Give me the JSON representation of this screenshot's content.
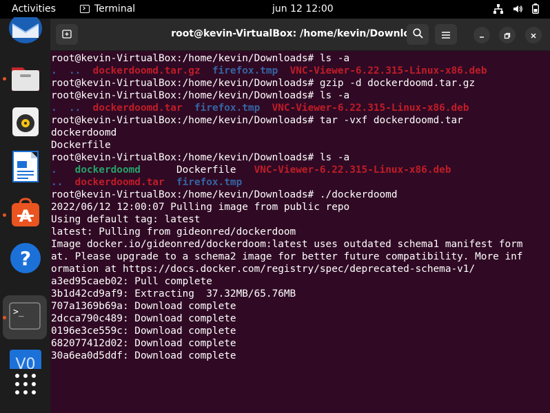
{
  "topbar": {
    "activities": "Activities",
    "app_name": "Terminal",
    "clock": "jun 12  12:00"
  },
  "dock": {
    "items": [
      "thunderbird-icon",
      "files-icon",
      "rhythmbox-icon",
      "writer-icon",
      "app-center-icon",
      "help-icon",
      "terminal-icon",
      "virtualbox-icon",
      "show-apps-icon"
    ]
  },
  "window": {
    "title": "root@kevin-VirtualBox: /home/kevin/Downloads"
  },
  "terminal": {
    "lines": [
      [
        {
          "t": "root@kevin-VirtualBox:/home/kevin/Downloads# ls -a",
          "c": "plain"
        }
      ],
      [
        {
          "t": ".  ..  ",
          "c": "dir"
        },
        {
          "t": "dockerdoomd.tar.gz",
          "c": "arc"
        },
        {
          "t": "  ",
          "c": "plain"
        },
        {
          "t": "firefox.tmp",
          "c": "dir"
        },
        {
          "t": "  ",
          "c": "plain"
        },
        {
          "t": "VNC-Viewer-6.22.315-Linux-x86.deb",
          "c": "arc"
        }
      ],
      [
        {
          "t": "root@kevin-VirtualBox:/home/kevin/Downloads# gzip -d dockerdoomd.tar.gz",
          "c": "plain"
        }
      ],
      [
        {
          "t": "root@kevin-VirtualBox:/home/kevin/Downloads# ls -a",
          "c": "plain"
        }
      ],
      [
        {
          "t": ".  ..  ",
          "c": "dir"
        },
        {
          "t": "dockerdoomd.tar",
          "c": "arc"
        },
        {
          "t": "  ",
          "c": "plain"
        },
        {
          "t": "firefox.tmp",
          "c": "dir"
        },
        {
          "t": "  ",
          "c": "plain"
        },
        {
          "t": "VNC-Viewer-6.22.315-Linux-x86.deb",
          "c": "arc"
        }
      ],
      [
        {
          "t": "root@kevin-VirtualBox:/home/kevin/Downloads# tar -vxf dockerdoomd.tar",
          "c": "plain"
        }
      ],
      [
        {
          "t": "dockerdoomd",
          "c": "plain"
        }
      ],
      [
        {
          "t": "Dockerfile",
          "c": "plain"
        }
      ],
      [
        {
          "t": "root@kevin-VirtualBox:/home/kevin/Downloads# ls -a",
          "c": "plain"
        }
      ],
      [
        {
          "t": ".   ",
          "c": "dir"
        },
        {
          "t": "dockerdoomd",
          "c": "exe"
        },
        {
          "t": "      Dockerfile   ",
          "c": "plain"
        },
        {
          "t": "VNC-Viewer-6.22.315-Linux-x86.deb",
          "c": "arc"
        }
      ],
      [
        {
          "t": "..  ",
          "c": "dir"
        },
        {
          "t": "dockerdoomd.tar",
          "c": "arc"
        },
        {
          "t": "  ",
          "c": "plain"
        },
        {
          "t": "firefox.tmp",
          "c": "dir"
        }
      ],
      [
        {
          "t": "root@kevin-VirtualBox:/home/kevin/Downloads# ./dockerdoomd",
          "c": "plain"
        }
      ],
      [
        {
          "t": "2022/06/12 12:00:07 Pulling image from public repo",
          "c": "plain"
        }
      ],
      [
        {
          "t": "Using default tag: latest",
          "c": "plain"
        }
      ],
      [
        {
          "t": "latest: Pulling from gideonred/dockerdoom",
          "c": "plain"
        }
      ],
      [
        {
          "t": "Image docker.io/gideonred/dockerdoom:latest uses outdated schema1 manifest form",
          "c": "plain"
        }
      ],
      [
        {
          "t": "at. Please upgrade to a schema2 image for better future compatibility. More inf",
          "c": "plain"
        }
      ],
      [
        {
          "t": "ormation at https://docs.docker.com/registry/spec/deprecated-schema-v1/",
          "c": "plain"
        }
      ],
      [
        {
          "t": "a3ed95caeb02: Pull complete",
          "c": "plain"
        }
      ],
      [
        {
          "t": "3b1d42cd9af9: Extracting  37.32MB/65.76MB",
          "c": "plain"
        }
      ],
      [
        {
          "t": "707a1369b69a: Download complete",
          "c": "plain"
        }
      ],
      [
        {
          "t": "2dcca790c489: Download complete",
          "c": "plain"
        }
      ],
      [
        {
          "t": "0196e3ce559c: Download complete",
          "c": "plain"
        }
      ],
      [
        {
          "t": "682077412d02: Download complete",
          "c": "plain"
        }
      ],
      [
        {
          "t": "30a6ea0d5ddf: Download complete",
          "c": "plain"
        }
      ]
    ]
  },
  "colors": {
    "terminal_bg": "#300a24",
    "directory": "#3465a4",
    "archive": "#c01c28",
    "executable": "#26a269",
    "accent": "#e95420"
  }
}
